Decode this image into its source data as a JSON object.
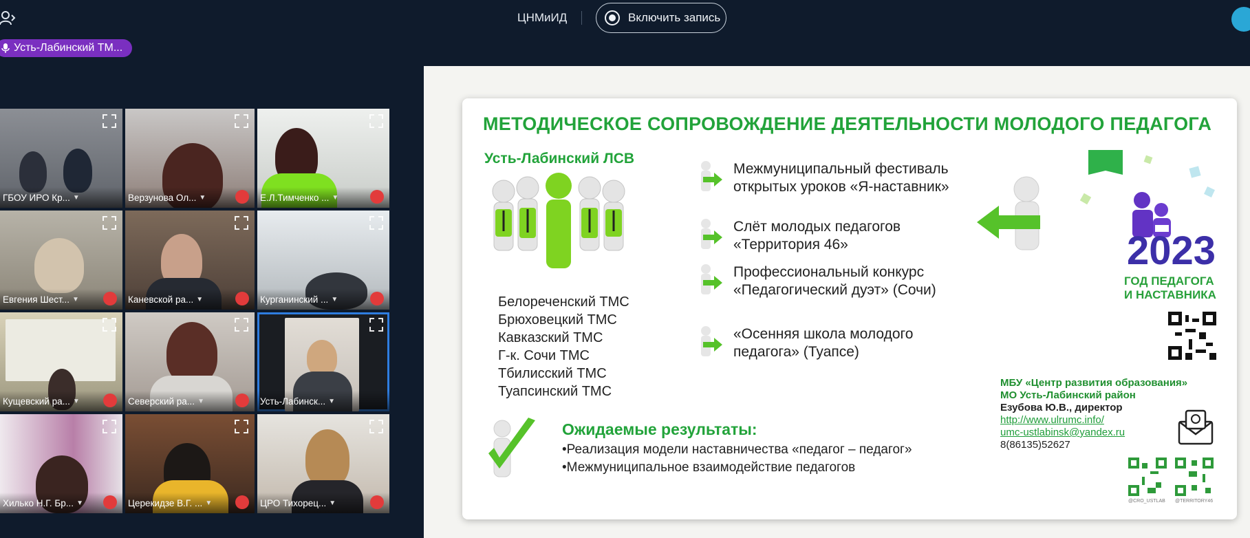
{
  "topbar": {
    "meeting_name": "ЦНМиИД",
    "record_label": "Включить запись"
  },
  "speaker": {
    "label": "Усть-Лабинский ТМ..."
  },
  "tiles": [
    {
      "name": "ГБОУ ИРО Кр...",
      "muted": true,
      "active": false
    },
    {
      "name": "Верзунова Ол...",
      "muted": true,
      "active": false
    },
    {
      "name": "Е.Л.Тимченко ...",
      "muted": true,
      "active": false
    },
    {
      "name": "Евгения Шест...",
      "muted": true,
      "active": false
    },
    {
      "name": "Каневской ра...",
      "muted": true,
      "active": false
    },
    {
      "name": "Курганинский ...",
      "muted": true,
      "active": false
    },
    {
      "name": "Кущевский ра...",
      "muted": true,
      "active": false
    },
    {
      "name": "Северский ра...",
      "muted": true,
      "active": false
    },
    {
      "name": "Усть-Лабинск...",
      "muted": false,
      "active": true
    },
    {
      "name": "Хилько Н.Г. Бр...",
      "muted": true,
      "active": false
    },
    {
      "name": "Церекидзе В.Г. ...",
      "muted": true,
      "active": false
    },
    {
      "name": "ЦРО Тихорец...",
      "muted": true,
      "active": false
    }
  ],
  "slide": {
    "title": "МЕТОДИЧЕСКОЕ СОПРОВОЖДЕНИЕ ДЕЯТЕЛЬНОСТИ МОЛОДОГО ПЕДАГОГА",
    "lsv_title": "Усть-Лабинский ЛСВ",
    "tms": [
      "Белореченский ТМС",
      "Брюховецкий  ТМС",
      "Кавказский ТМС",
      "Г-к. Сочи ТМС",
      "Тбилисский ТМС",
      "Туапсинский ТМС"
    ],
    "events": [
      "Межмуниципальный фестиваль открытых уроков «Я-наставник»",
      "Слёт молодых педагогов «Территория 46»",
      "Профессиональный конкурс «Педагогический дуэт» (Сочи)",
      "«Осенняя школа молодого педагога» (Туапсе)"
    ],
    "year": "2023",
    "year_sub_1": "ГОД ПЕДАГОГА",
    "year_sub_2": "И НАСТАВНИКА",
    "results_title": "Ожидаемые результаты:",
    "results": [
      "•Реализация модели наставничества «педагог – педагог»",
      "•Межмуниципальное взаимодействие педагогов"
    ],
    "org_line1": "МБУ «Центр развития образования»",
    "org_line2": "МО Усть-Лабинский район",
    "director": "Езубова Ю.В., директор",
    "site": "http://www.ulrumc.info/",
    "email": "umc-ustlabinsk@yandex.ru",
    "phone": "8(86135)52627",
    "qr_caption_1": "@CRO_USTLAB",
    "qr_caption_2": "@TERRITORY46"
  },
  "colors": {
    "bg": "#0f1b2c",
    "accent_green": "#22a33a",
    "speaker_pill": "#7a2fc0",
    "active_tile": "#2f7de0",
    "mute": "#e23b3b",
    "year_blue": "#3c2fa8"
  }
}
